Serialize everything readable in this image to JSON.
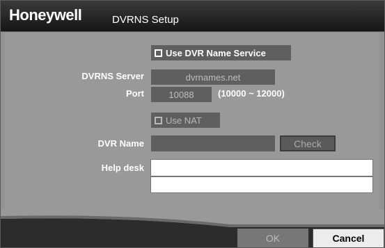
{
  "window": {
    "brand": "Honeywell",
    "title": "DVRNS Setup"
  },
  "form": {
    "use_dvrns_label": "Use DVR Name Service",
    "use_dvrns_checked": false,
    "server_label": "DVRNS Server",
    "server_value": "dvrnames.net",
    "port_label": "Port",
    "port_value": "10088",
    "port_range": "(10000 ~ 12000)",
    "use_nat_label": "Use NAT",
    "use_nat_checked": false,
    "dvr_name_label": "DVR Name",
    "dvr_name_value": "",
    "check_label": "Check",
    "help_desk_label": "Help desk",
    "help_desk_line1": "",
    "help_desk_line2": ""
  },
  "buttons": {
    "ok_label": "OK",
    "cancel_label": "Cancel"
  }
}
